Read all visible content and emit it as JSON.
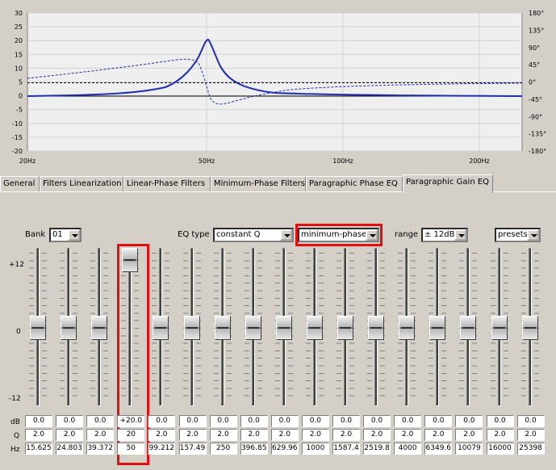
{
  "graph": {
    "y_left_ticks": [
      "30",
      "25",
      "20",
      "15",
      "10",
      "5",
      "0",
      "-5",
      "-10",
      "-15",
      "-20"
    ],
    "y_right_ticks": [
      "180°",
      "135°",
      "90°",
      "45°",
      "0°",
      "-45°",
      "-90°",
      "-135°",
      "-180°"
    ],
    "x_ticks": [
      "20Hz",
      "50Hz",
      "100Hz",
      "200Hz"
    ],
    "colors": {
      "curve": "#1e2fb0",
      "plot_bg": "#efefef",
      "grid": "#d0d0d0"
    }
  },
  "tabs": [
    {
      "label": "General"
    },
    {
      "label": "Filters Linearization"
    },
    {
      "label": "Linear-Phase Filters"
    },
    {
      "label": "Minimum-Phase Filters"
    },
    {
      "label": "Paragraphic Phase EQ"
    },
    {
      "label": "Paragraphic Gain EQ",
      "active": true
    }
  ],
  "controls": {
    "bank_label": "Bank",
    "bank_value": "01",
    "eqtype_label": "EQ type",
    "eqtype_value": "constant Q",
    "phase_value": "minimum-phase",
    "range_label": "range",
    "range_value": "± 12dB",
    "presets_value": "presets"
  },
  "scale": {
    "top": "+12",
    "mid": "0",
    "bottom": "-12"
  },
  "row_labels": {
    "db": "dB",
    "q": "Q",
    "hz": "Hz"
  },
  "bands": [
    {
      "db": "0.0",
      "q": "2.0",
      "hz": "15.625",
      "level": 0.5
    },
    {
      "db": "0.0",
      "q": "2.0",
      "hz": "24.803",
      "level": 0.5
    },
    {
      "db": "0.0",
      "q": "2.0",
      "hz": "39.372",
      "level": 0.5
    },
    {
      "db": "+20.0",
      "q": "20",
      "hz": "50",
      "level": 1.0
    },
    {
      "db": "0.0",
      "q": "2.0",
      "hz": "99.212",
      "level": 0.5
    },
    {
      "db": "0.0",
      "q": "2.0",
      "hz": "157.49",
      "level": 0.5
    },
    {
      "db": "0.0",
      "q": "2.0",
      "hz": "250",
      "level": 0.5
    },
    {
      "db": "0.0",
      "q": "2.0",
      "hz": "396.85",
      "level": 0.5
    },
    {
      "db": "0.0",
      "q": "2.0",
      "hz": "629.96",
      "level": 0.5
    },
    {
      "db": "0.0",
      "q": "2.0",
      "hz": "1000",
      "level": 0.5
    },
    {
      "db": "0.0",
      "q": "2.0",
      "hz": "1587.4",
      "level": 0.5
    },
    {
      "db": "0.0",
      "q": "2.0",
      "hz": "2519.8",
      "level": 0.5
    },
    {
      "db": "0.0",
      "q": "2.0",
      "hz": "4000",
      "level": 0.5
    },
    {
      "db": "0.0",
      "q": "2.0",
      "hz": "6349.6",
      "level": 0.5
    },
    {
      "db": "0.0",
      "q": "2.0",
      "hz": "10079",
      "level": 0.5
    },
    {
      "db": "0.0",
      "q": "2.0",
      "hz": "16000",
      "level": 0.5
    },
    {
      "db": "0.0",
      "q": "2.0",
      "hz": "25398",
      "level": 0.5
    }
  ]
}
